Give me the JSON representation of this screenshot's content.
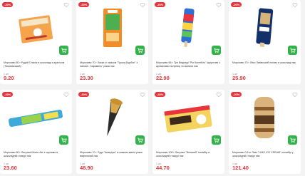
{
  "currency": "грн",
  "products": [
    {
      "discount": "-20%",
      "title": "Морозиво 80 г Рудий Сніжок в шоколаді з арахісом (Тимохівський)",
      "unit": "1 шт",
      "price": "9.20"
    },
    {
      "discount": "-20%",
      "title": "Морозиво 70 г Лакка зі смаком \"Груша-Бурбон\" з наповн. \"карамель\" ріжок пак",
      "unit": "1 шт",
      "price": "23.30"
    },
    {
      "discount": "-20%",
      "title": "Морозиво 66 г Три Ведмеді \"Ріо Коктейль\" фруктове з ароматами полуниці та малини пак",
      "unit": "1 шт",
      "price": "22.90"
    },
    {
      "discount": "-20%",
      "title": "Морозиво 70 г Лімо Львівський ескімо в шоколаді пак",
      "unit": "1 шт",
      "price": "25.90"
    },
    {
      "discount": "-20%",
      "title": "Морозиво 80 г Ласунка Monte Ale з горіхами в шоколадній глазурі пак",
      "unit": "1 шт",
      "price": "23.60"
    },
    {
      "discount": "-20%",
      "title": "Морозиво 70 г Рудь \"Імперіум\" зі смаком ванілі ріжок вафельний пак",
      "unit": "1 шт",
      "price": "48.90"
    },
    {
      "discount": "-20%",
      "title": "Морозиво 100 г Ласунка \"Великий\" пломбір в шоколадній глазурі пак",
      "unit": "1 шт",
      "price": "44.70"
    },
    {
      "discount": "-20%",
      "title": "Морозиво 0.5 кг Лімо \"LIMO ICE CREAM\" пломбір у шоколадній глазурі пак",
      "unit": "1 шт",
      "price": "121.40"
    }
  ]
}
